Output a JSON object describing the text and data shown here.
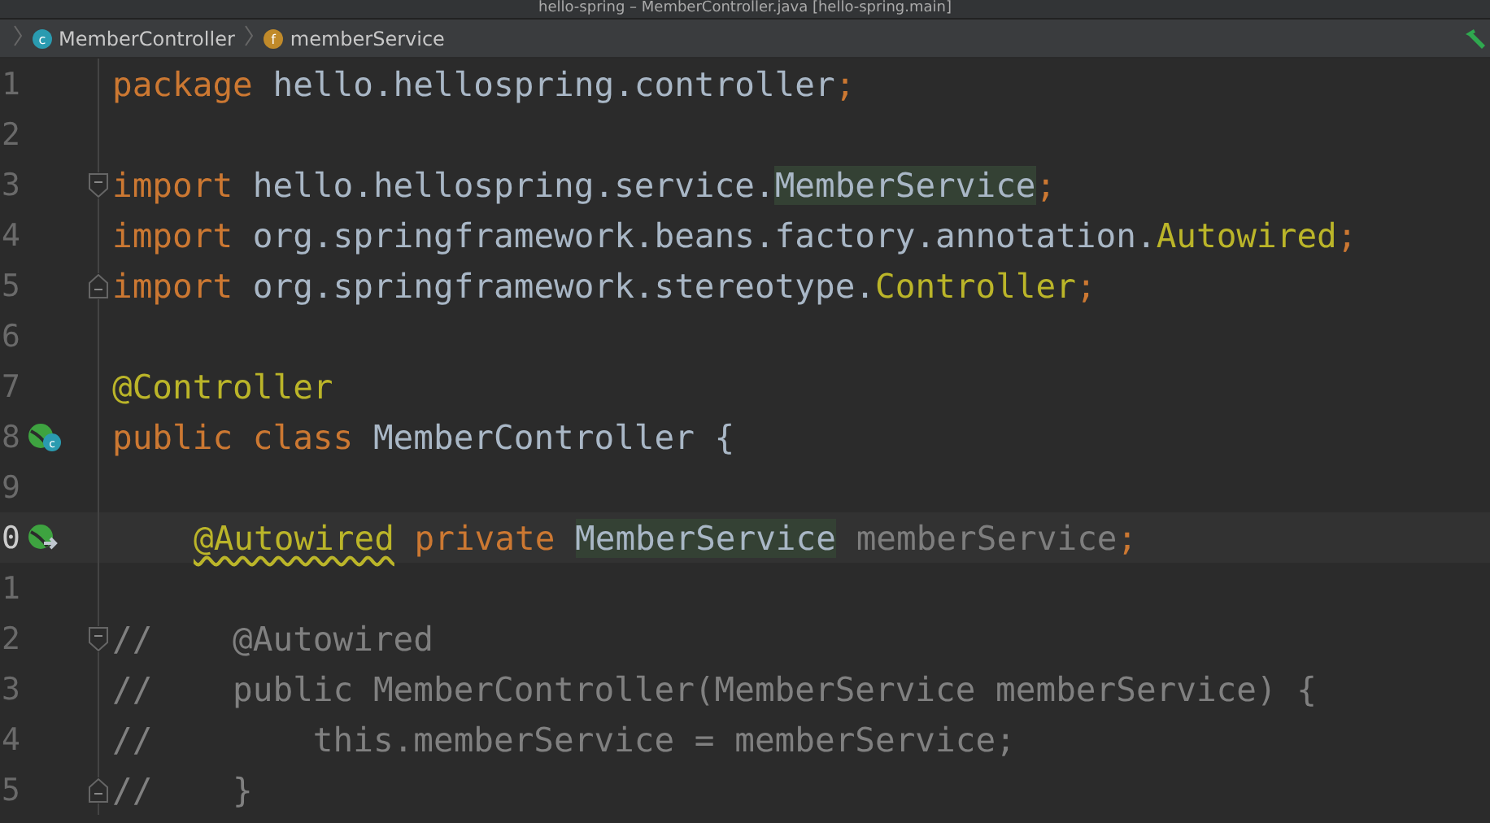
{
  "window": {
    "title": "hello-spring – MemberController.java [hello-spring.main]"
  },
  "breadcrumbs": [
    {
      "label": "MemberController",
      "kind": "class",
      "icon_letter": "c"
    },
    {
      "label": "memberService",
      "kind": "field",
      "icon_letter": "f"
    }
  ],
  "editor": {
    "lines": [
      {
        "number": "1",
        "tokens": [
          {
            "text": "package",
            "kind": "keyword"
          },
          {
            "text": "hello.hellospring.controller",
            "kind": "plain"
          },
          {
            "text": ";",
            "kind": "keyword",
            "join": true
          }
        ]
      },
      {
        "number": "2"
      },
      {
        "number": "3",
        "fold": {
          "kind": "start"
        },
        "tokens": [
          {
            "text": "import",
            "kind": "keyword"
          },
          {
            "text": "hello.hellospring.service.",
            "kind": "plain"
          },
          {
            "text": "MemberService",
            "kind": "plain",
            "join": true,
            "highlighted": true
          },
          {
            "text": ";",
            "kind": "keyword",
            "join": true
          }
        ]
      },
      {
        "number": "4",
        "tokens": [
          {
            "text": "import",
            "kind": "keyword"
          },
          {
            "text": "org.springframework.beans.factory.annotation.",
            "kind": "plain"
          },
          {
            "text": "Autowired",
            "kind": "annotation",
            "join": true
          },
          {
            "text": ";",
            "kind": "keyword",
            "join": true
          }
        ]
      },
      {
        "number": "5",
        "fold": {
          "kind": "end"
        },
        "tokens": [
          {
            "text": "import",
            "kind": "keyword"
          },
          {
            "text": "org.springframework.stereotype.",
            "kind": "plain"
          },
          {
            "text": "Controller",
            "kind": "annotation",
            "join": true
          },
          {
            "text": ";",
            "kind": "keyword",
            "join": true
          }
        ]
      },
      {
        "number": "6"
      },
      {
        "number": "7",
        "tokens": [
          {
            "text": "@Controller",
            "kind": "annotation"
          }
        ]
      },
      {
        "number": "8",
        "gutter_icon": {
          "kind": "bean-class",
          "letter": "c"
        },
        "tokens": [
          {
            "text": "public",
            "kind": "keyword"
          },
          {
            "text": "class",
            "kind": "keyword"
          },
          {
            "text": "MemberController",
            "kind": "plain"
          },
          {
            "text": "{",
            "kind": "plain"
          }
        ]
      },
      {
        "number": "9"
      },
      {
        "number": "0",
        "gutter_icon": {
          "kind": "bean-inject"
        },
        "current": true,
        "indented": true,
        "tokens": [
          {
            "text": "@Autowired",
            "kind": "annotation",
            "warning": true
          },
          {
            "text": "private",
            "kind": "keyword"
          },
          {
            "text": "MemberService",
            "kind": "plain",
            "highlighted": true
          },
          {
            "text": "memberService",
            "kind": "unused"
          },
          {
            "text": ";",
            "kind": "keyword",
            "join": true
          }
        ]
      },
      {
        "number": "1"
      },
      {
        "number": "2",
        "fold": {
          "kind": "start"
        },
        "tokens": [
          {
            "text": "//    @Autowired",
            "kind": "comment"
          }
        ]
      },
      {
        "number": "3",
        "tokens": [
          {
            "text": "//    public MemberController(MemberService memberService) {",
            "kind": "comment"
          }
        ]
      },
      {
        "number": "4",
        "tokens": [
          {
            "text": "//        this.memberService = memberService;",
            "kind": "comment"
          }
        ]
      },
      {
        "number": "5",
        "fold": {
          "kind": "end"
        },
        "tokens": [
          {
            "text": "//    }",
            "kind": "comment"
          }
        ]
      }
    ]
  }
}
